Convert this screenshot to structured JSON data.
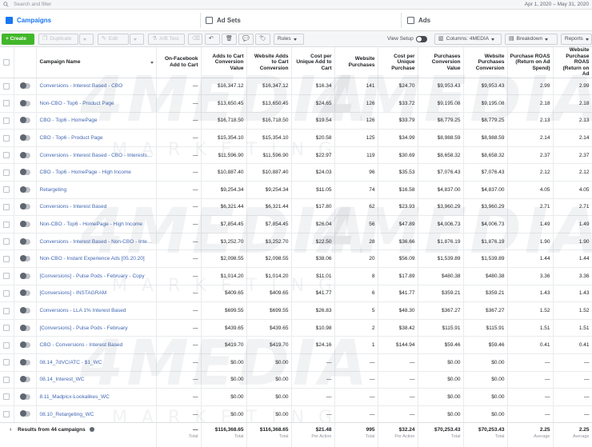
{
  "search": {
    "placeholder": "Search and filter"
  },
  "date_range": "Apr 1, 2020 – May 31, 2020",
  "tabs": [
    {
      "label": "Campaigns"
    },
    {
      "label": "Ad Sets"
    },
    {
      "label": "Ads"
    }
  ],
  "toolbar": {
    "create_label": "+ Create",
    "duplicate_label": "Duplicate",
    "edit_label": "Edit",
    "ab_test_label": "A/B Test",
    "rules_label": "Rules",
    "view_setup_label": "View Setup",
    "columns_label": "Columns: 4MEDIA",
    "breakdown_label": "Breakdown",
    "reports_label": "Reports"
  },
  "columns": [
    "Campaign Name",
    "On-Facebook Add to Cart",
    "Adds to Cart Conversion Value",
    "Website Adds to Cart Conversion",
    "Cost per Unique Add to Cart",
    "Website Purchases",
    "Cost per Unique Purchase",
    "Purchases Conversion Value",
    "Website Purchases Conversion",
    "Purchase ROAS (Return on Ad Spend)",
    "Website Purchase ROAS (Return on Ad"
  ],
  "rows": [
    {
      "name": "Conversions - Interest Based - CBO",
      "c1": "—",
      "c2": "$16,347.12",
      "c3": "$16,347.12",
      "c4": "$16.34",
      "c5": "141",
      "c6": "$24.70",
      "c7": "$9,953.43",
      "c8": "$9,953.43",
      "c9": "2.99",
      "c10": "2.99"
    },
    {
      "name": "Non-CBO - Top6 - Product Page",
      "c1": "—",
      "c2": "$13,650.45",
      "c3": "$13,650.45",
      "c4": "$24.65",
      "c5": "126",
      "c6": "$33.72",
      "c7": "$9,195.08",
      "c8": "$9,195.08",
      "c9": "2.18",
      "c10": "2.18"
    },
    {
      "name": "CBO - Top6 - HomePage",
      "c1": "—",
      "c2": "$16,718.50",
      "c3": "$16,718.50",
      "c4": "$19.54",
      "c5": "126",
      "c6": "$33.79",
      "c7": "$8,779.25",
      "c8": "$8,779.25",
      "c9": "2.13",
      "c10": "2.13"
    },
    {
      "name": "CBO - Top6 - Product Page",
      "c1": "—",
      "c2": "$15,354.10",
      "c3": "$15,354.10",
      "c4": "$20.58",
      "c5": "125",
      "c6": "$34.99",
      "c7": "$8,988.59",
      "c8": "$8,988.59",
      "c9": "2.14",
      "c10": "2.14"
    },
    {
      "name": "Conversions - Interest Based - CBO - Interests…",
      "c1": "—",
      "c2": "$11,596.90",
      "c3": "$11,596.90",
      "c4": "$22.97",
      "c5": "119",
      "c6": "$30.69",
      "c7": "$8,658.32",
      "c8": "$8,658.32",
      "c9": "2.37",
      "c10": "2.37"
    },
    {
      "name": "CBO - Top6 - HomePage - High Income",
      "c1": "—",
      "c2": "$10,887.40",
      "c3": "$10,887.40",
      "c4": "$24.03",
      "c5": "96",
      "c6": "$35.53",
      "c7": "$7,076.43",
      "c8": "$7,076.43",
      "c9": "2.12",
      "c10": "2.12"
    },
    {
      "name": "Retargeting",
      "c1": "—",
      "c2": "$9,254.34",
      "c3": "$9,254.34",
      "c4": "$11.05",
      "c5": "74",
      "c6": "$16.58",
      "c7": "$4,837.00",
      "c8": "$4,837.00",
      "c9": "4.05",
      "c10": "4.05"
    },
    {
      "name": "Conversions - Interest Based",
      "c1": "—",
      "c2": "$6,321.44",
      "c3": "$6,321.44",
      "c4": "$17.80",
      "c5": "62",
      "c6": "$23.93",
      "c7": "$3,960.29",
      "c8": "$3,960.29",
      "c9": "2.71",
      "c10": "2.71"
    },
    {
      "name": "Non-CBO - Top6 - HomePage - High Income",
      "c1": "—",
      "c2": "$7,854.45",
      "c3": "$7,854.45",
      "c4": "$26.04",
      "c5": "56",
      "c6": "$47.89",
      "c7": "$4,006.73",
      "c8": "$4,006.73",
      "c9": "1.49",
      "c10": "1.49"
    },
    {
      "name": "Conversions - Interest Based - Non-CBO - Inte…",
      "c1": "—",
      "c2": "$3,252.70",
      "c3": "$3,252.70",
      "c4": "$22.50",
      "c5": "28",
      "c6": "$36.66",
      "c7": "$1,876.19",
      "c8": "$1,876.19",
      "c9": "1.90",
      "c10": "1.90"
    },
    {
      "name": "Non-CBO - Instant Experience Ads [05.20.20]",
      "c1": "—",
      "c2": "$2,098.55",
      "c3": "$2,098.55",
      "c4": "$38.06",
      "c5": "20",
      "c6": "$56.09",
      "c7": "$1,539.89",
      "c8": "$1,539.89",
      "c9": "1.44",
      "c10": "1.44"
    },
    {
      "name": "[Conversions] - Pulse Pods - February - Copy",
      "c1": "—",
      "c2": "$1,014.20",
      "c3": "$1,014.20",
      "c4": "$11.01",
      "c5": "8",
      "c6": "$17.89",
      "c7": "$480.38",
      "c8": "$480.38",
      "c9": "3.36",
      "c10": "3.36"
    },
    {
      "name": "[Conversions] - INSTAGRAM",
      "c1": "—",
      "c2": "$409.65",
      "c3": "$409.65",
      "c4": "$41.77",
      "c5": "6",
      "c6": "$41.77",
      "c7": "$359.21",
      "c8": "$359.21",
      "c9": "1.43",
      "c10": "1.43"
    },
    {
      "name": "Conversions - LLA 1% Interest Based",
      "c1": "—",
      "c2": "$699.55",
      "c3": "$699.55",
      "c4": "$26.83",
      "c5": "5",
      "c6": "$48.30",
      "c7": "$367.27",
      "c8": "$367.27",
      "c9": "1.52",
      "c10": "1.52"
    },
    {
      "name": "[Conversions] - Pulse Pods - February",
      "c1": "—",
      "c2": "$439.65",
      "c3": "$439.65",
      "c4": "$10.98",
      "c5": "2",
      "c6": "$38.42",
      "c7": "$115.91",
      "c8": "$115.91",
      "c9": "1.51",
      "c10": "1.51"
    },
    {
      "name": "CBO - Conversions - Interest Based",
      "c1": "—",
      "c2": "$419.70",
      "c3": "$419.70",
      "c4": "$24.16",
      "c5": "1",
      "c6": "$144.94",
      "c7": "$59.46",
      "c8": "$59.46",
      "c9": "0.41",
      "c10": "0.41"
    },
    {
      "name": "08.14_7dVC/ATC - $1_WC",
      "c1": "—",
      "c2": "$0.00",
      "c3": "$0.00",
      "c4": "—",
      "c5": "—",
      "c6": "—",
      "c7": "$0.00",
      "c8": "$0.00",
      "c9": "—",
      "c10": "—"
    },
    {
      "name": "08.14_Interest_WC",
      "c1": "—",
      "c2": "$0.00",
      "c3": "$0.00",
      "c4": "—",
      "c5": "—",
      "c6": "—",
      "c7": "$0.00",
      "c8": "$0.00",
      "c9": "—",
      "c10": "—"
    },
    {
      "name": "8.11_Madpicx-Lookalikes_WC",
      "c1": "—",
      "c2": "$0.00",
      "c3": "$0.00",
      "c4": "—",
      "c5": "—",
      "c6": "—",
      "c7": "$0.00",
      "c8": "$0.00",
      "c9": "—",
      "c10": "—"
    },
    {
      "name": "08.10_Retargeting_WC",
      "c1": "—",
      "c2": "$0.00",
      "c3": "$0.00",
      "c4": "—",
      "c5": "—",
      "c6": "—",
      "c7": "$0.00",
      "c8": "$0.00",
      "c9": "—",
      "c10": "—"
    },
    {
      "name": "Madpicx - Acquisition Re-Engagement Camp…",
      "c1": "—",
      "c2": "$0.00",
      "c3": "$0.00",
      "c4": "—",
      "c5": "—",
      "c6": "—",
      "c7": "$0.00",
      "c8": "$0.00",
      "c9": "—",
      "c10": "—"
    }
  ],
  "totals": {
    "label": "Results from 44 campaigns",
    "c1": "—",
    "c1_sub": "Total",
    "c2": "$116,368.65",
    "c2_sub": "Total",
    "c3": "$116,368.65",
    "c3_sub": "Total",
    "c4": "$21.48",
    "c4_sub": "Per Action",
    "c5": "995",
    "c5_sub": "Total",
    "c6": "$32.24",
    "c6_sub": "Per Action",
    "c7": "$70,253.43",
    "c7_sub": "Total",
    "c8": "$70,253.43",
    "c8_sub": "Total",
    "c9": "2.25",
    "c9_sub": "Average",
    "c10": "2.25",
    "c10_sub": "Average"
  },
  "watermark": {
    "big": "4MEDIA",
    "small": "MARKETING"
  },
  "colors": {
    "accent": "#1877f2",
    "create": "#42b72a",
    "link": "#4267b2"
  }
}
